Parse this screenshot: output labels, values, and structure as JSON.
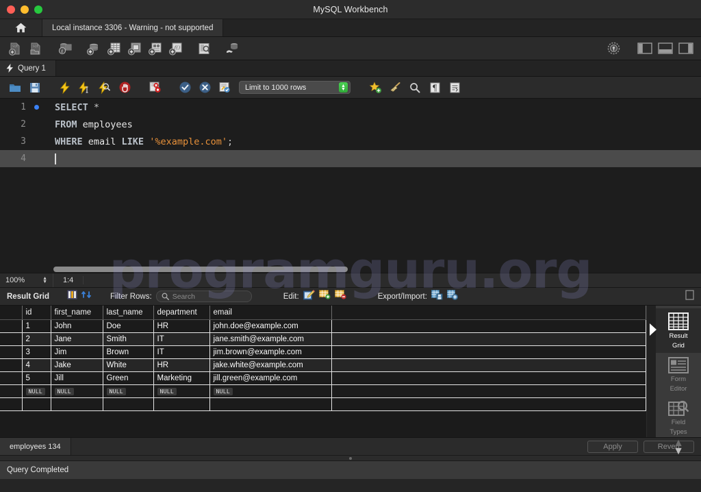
{
  "window": {
    "title": "MySQL Workbench",
    "traffic_lights": [
      "close",
      "minimize",
      "maximize"
    ]
  },
  "instance_bar": {
    "home_icon": "home-icon",
    "tab_label": "Local instance 3306 - Warning - not supported"
  },
  "main_toolbar": {
    "left_buttons": [
      {
        "name": "new-sql-file-button",
        "icon": "new-sql-file-icon"
      },
      {
        "name": "open-sql-file-button",
        "icon": "open-sql-file-icon"
      },
      {
        "name": "server-status-button",
        "icon": "server-info-icon"
      },
      {
        "name": "new-schema-button",
        "icon": "new-schema-icon"
      },
      {
        "name": "new-table-button",
        "icon": "new-table-icon"
      },
      {
        "name": "new-view-button",
        "icon": "new-view-icon"
      },
      {
        "name": "new-procedure-button",
        "icon": "new-procedure-icon"
      },
      {
        "name": "new-function-button",
        "icon": "new-function-icon"
      },
      {
        "name": "inspect-button",
        "icon": "inspect-icon"
      },
      {
        "name": "reconnect-server-button",
        "icon": "reconnect-icon"
      }
    ],
    "right_buttons": [
      {
        "name": "settings-button",
        "icon": "gear-icon"
      },
      {
        "name": "toggle-sidebar-button",
        "icon": "panel-left-icon"
      },
      {
        "name": "toggle-output-button",
        "icon": "panel-bottom-icon"
      },
      {
        "name": "toggle-secondary-sidebar-button",
        "icon": "panel-right-icon"
      }
    ]
  },
  "query_tab": {
    "icon": "lightning-icon",
    "label": "Query 1"
  },
  "editor_toolbar": {
    "buttons": [
      {
        "name": "open-file-button",
        "icon": "folder-icon"
      },
      {
        "name": "save-file-button",
        "icon": "floppy-icon"
      },
      {
        "name": "execute-button",
        "icon": "lightning-bolt-icon"
      },
      {
        "name": "execute-current-statement-button",
        "icon": "lightning-cursor-icon"
      },
      {
        "name": "explain-button",
        "icon": "lightning-magnifier-icon"
      },
      {
        "name": "stop-button",
        "icon": "stop-hand-icon"
      },
      {
        "name": "toggle-stop-on-error-button",
        "icon": "stop-on-error-icon"
      },
      {
        "name": "commit-button",
        "icon": "check-circle-icon"
      },
      {
        "name": "rollback-button",
        "icon": "x-circle-icon"
      },
      {
        "name": "autocommit-button",
        "icon": "autocommit-icon"
      }
    ],
    "limit_label": "Limit to 1000 rows",
    "right_buttons": [
      {
        "name": "beautify-query-button",
        "icon": "star-plus-icon"
      },
      {
        "name": "clear-query-button",
        "icon": "broom-icon"
      },
      {
        "name": "find-button",
        "icon": "magnifier-icon"
      },
      {
        "name": "toggle-invisible-chars-button",
        "icon": "pilcrow-icon"
      },
      {
        "name": "toggle-word-wrap-button",
        "icon": "wrap-text-icon"
      }
    ]
  },
  "editor": {
    "lines": [
      {
        "num": "1",
        "breakpoint": true,
        "tokens": [
          {
            "t": "SELECT",
            "c": "kw"
          },
          {
            "t": " ",
            "c": "plain"
          },
          {
            "t": "*",
            "c": "punc"
          }
        ]
      },
      {
        "num": "2",
        "breakpoint": false,
        "tokens": [
          {
            "t": "FROM",
            "c": "kw"
          },
          {
            "t": " employees",
            "c": "plain"
          }
        ]
      },
      {
        "num": "3",
        "breakpoint": false,
        "tokens": [
          {
            "t": "WHERE",
            "c": "kw"
          },
          {
            "t": " email ",
            "c": "plain"
          },
          {
            "t": "LIKE",
            "c": "kw"
          },
          {
            "t": " ",
            "c": "plain"
          },
          {
            "t": "'%example.com'",
            "c": "str"
          },
          {
            "t": ";",
            "c": "punc"
          }
        ]
      },
      {
        "num": "4",
        "breakpoint": false,
        "active": true,
        "tokens": []
      }
    ],
    "zoom_level": "100%",
    "cursor_position": "1:4"
  },
  "result_toolbar": {
    "title": "Result Grid",
    "grid_icon": "grid-icon",
    "refresh_icon": "refresh-icon",
    "filter_label": "Filter Rows:",
    "search_placeholder": "Search",
    "search_value": "",
    "search_icon": "magnifier-icon",
    "edit_label": "Edit:",
    "edit_buttons": [
      {
        "name": "edit-cell-button",
        "icon": "pencil-edit-icon"
      },
      {
        "name": "insert-row-button",
        "icon": "row-add-icon"
      },
      {
        "name": "delete-row-button",
        "icon": "row-delete-icon"
      }
    ],
    "export_label": "Export/Import:",
    "export_buttons": [
      {
        "name": "export-recordset-button",
        "icon": "export-grid-icon"
      },
      {
        "name": "import-recordset-button",
        "icon": "import-grid-icon"
      }
    ],
    "wrap_cell_button": {
      "name": "toggle-wrap-cell-button",
      "icon": "wrap-cell-icon"
    }
  },
  "result_grid": {
    "columns": [
      "id",
      "first_name",
      "last_name",
      "department",
      "email"
    ],
    "rows": [
      [
        "1",
        "John",
        "Doe",
        "HR",
        "john.doe@example.com"
      ],
      [
        "2",
        "Jane",
        "Smith",
        "IT",
        "jane.smith@example.com"
      ],
      [
        "3",
        "Jim",
        "Brown",
        "IT",
        "jim.brown@example.com"
      ],
      [
        "4",
        "Jake",
        "White",
        "HR",
        "jake.white@example.com"
      ],
      [
        "5",
        "Jill",
        "Green",
        "Marketing",
        "jill.green@example.com"
      ]
    ],
    "null_placeholder": "NULL"
  },
  "side_panel": {
    "items": [
      {
        "label_line1": "Result",
        "label_line2": "Grid",
        "icon": "result-grid-icon",
        "active": true
      },
      {
        "label_line1": "Form",
        "label_line2": "Editor",
        "icon": "form-editor-icon",
        "active": false
      },
      {
        "label_line1": "Field",
        "label_line2": "Types",
        "icon": "field-types-icon",
        "active": false
      }
    ],
    "chevron_up": "▲",
    "chevron_down": "▼"
  },
  "bottom": {
    "result_tab_label": "employees 134",
    "apply_label": "Apply",
    "revert_label": "Revert"
  },
  "statusbar": {
    "message": "Query Completed"
  },
  "watermark": {
    "text": "programguru.org"
  },
  "colors": {
    "accent_blue": "#3b82f6",
    "keyword": "#b9c0c8",
    "string": "#e8913a",
    "window_bg": "#252525",
    "editor_bg": "#1d1d1d"
  }
}
